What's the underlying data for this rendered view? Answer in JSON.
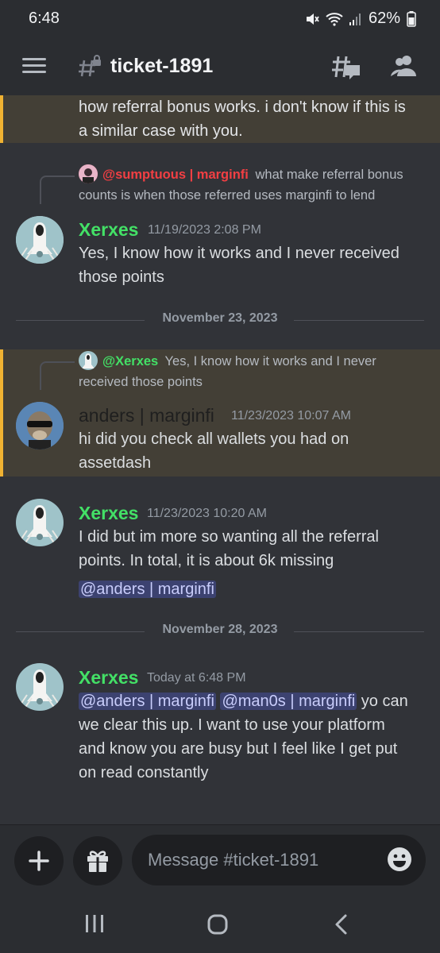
{
  "status": {
    "time": "6:48",
    "battery": "62%"
  },
  "header": {
    "channel": "ticket-1891"
  },
  "top_message": {
    "lines": [
      "how referral bonus works. i don't know if this is",
      "a similar case with you."
    ]
  },
  "msg1": {
    "reply_name": "@sumptuous | marginfi",
    "reply_text_1": "what make referral bonus",
    "reply_text_2": "counts is when those referred uses marginfi to lend",
    "author": "Xerxes",
    "timestamp": "11/19/2023 2:08 PM",
    "lines": [
      "Yes, I know how it works and I never received",
      "those points"
    ]
  },
  "divider1": "November 23, 2023",
  "msg2": {
    "reply_name": "@Xerxes",
    "reply_text_1": "Yes, I know how it works and I never",
    "reply_text_2": "received those points",
    "author": "anders | marginfi",
    "timestamp": "11/23/2023 10:07 AM",
    "lines": [
      "hi did you check all wallets you had on",
      "assetdash"
    ]
  },
  "msg3": {
    "author": "Xerxes",
    "timestamp": "11/23/2023 10:20 AM",
    "lines": [
      "I did but im more so wanting all the referral",
      "points. In total, it is about 6k missing"
    ],
    "mention": "@anders | marginfi"
  },
  "divider2": "November 28, 2023",
  "msg4": {
    "author": "Xerxes",
    "timestamp": "Today at 6:48 PM",
    "mention1": "@anders | marginfi",
    "mention2": "@man0s | marginfi",
    "line1_rest": " yo can",
    "lines": [
      "we clear this up. I want to use your platform",
      "and know you are busy but I feel like I get put",
      "on read constantly"
    ]
  },
  "composer": {
    "placeholder": "Message #ticket-1891"
  },
  "colors": {
    "xerxes": "#43e066",
    "mention_bg": "#3c4270",
    "highlight": "#433f36",
    "highlight_bar": "#f0b232",
    "sumptuous": "#f23f43"
  },
  "icons": [
    "menu-icon",
    "channel-lock-icon",
    "threads-icon",
    "members-icon",
    "plus-icon",
    "gift-icon",
    "emoji-icon",
    "recent-apps-icon",
    "home-icon",
    "back-icon",
    "mute-icon",
    "wifi-icon",
    "signal-icon",
    "battery-icon"
  ]
}
